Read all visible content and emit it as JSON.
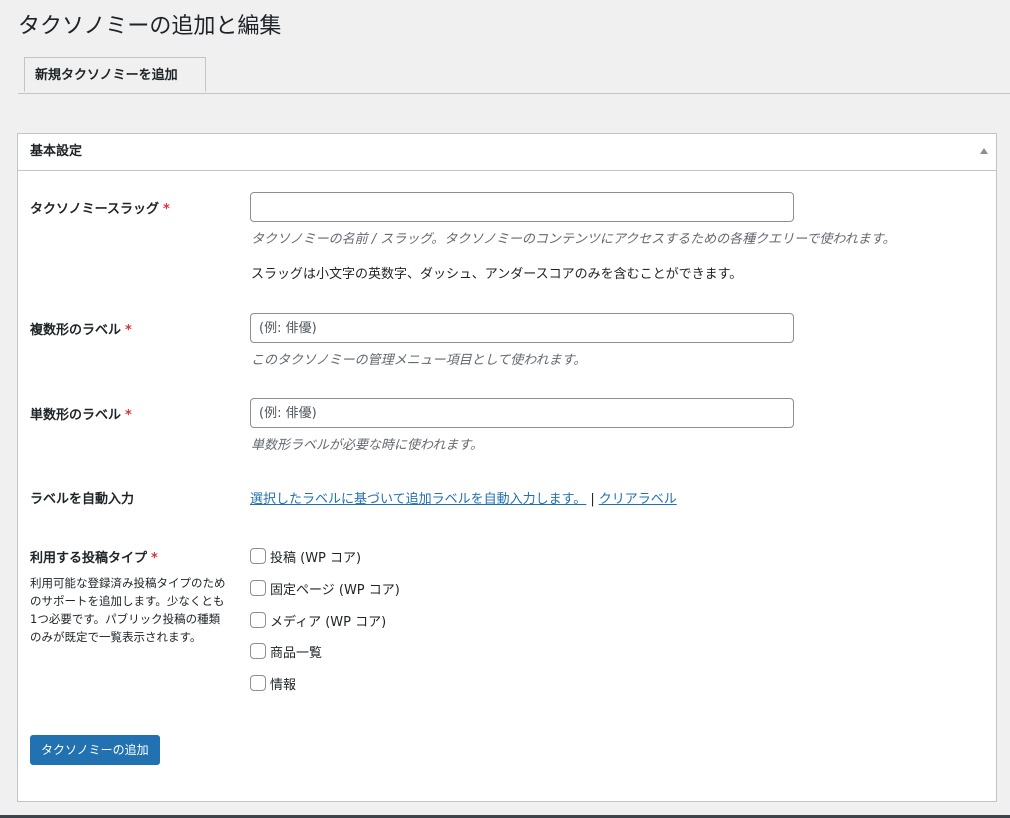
{
  "page": {
    "title": "タクソノミーの追加と編集"
  },
  "tabs": [
    {
      "label": "新規タクソノミーを追加"
    }
  ],
  "panel": {
    "title": "基本設定",
    "required_mark": "*",
    "slug": {
      "label": "タクソノミースラッグ",
      "value": "",
      "placeholder": "",
      "description": "タクソノミーの名前 / スラッグ。タクソノミーのコンテンツにアクセスするための各種クエリーで使われます。",
      "note": "スラッグは小文字の英数字、ダッシュ、アンダースコアのみを含むことができます。"
    },
    "plural": {
      "label": "複数形のラベル",
      "value": "",
      "placeholder": "(例: 俳優)",
      "description": "このタクソノミーの管理メニュー項目として使われます。"
    },
    "singular": {
      "label": "単数形のラベル",
      "value": "",
      "placeholder": "(例: 俳優)",
      "description": "単数形ラベルが必要な時に使われます。"
    },
    "autofill": {
      "label": "ラベルを自動入力",
      "populate_link": "選択したラベルに基づいて追加ラベルを自動入力します。",
      "separator": "|",
      "clear_link": "クリアラベル"
    },
    "post_types": {
      "label": "利用する投稿タイプ",
      "description": "利用可能な登録済み投稿タイプのためのサポートを追加します。少なくとも1つ必要です。パブリック投稿の種類のみが既定で一覧表示されます。",
      "options": [
        {
          "label": "投稿 (WP コア)",
          "checked": false
        },
        {
          "label": "固定ページ (WP コア)",
          "checked": false
        },
        {
          "label": "メディア (WP コア)",
          "checked": false
        },
        {
          "label": "商品一覧",
          "checked": false
        },
        {
          "label": "情報",
          "checked": false
        }
      ]
    },
    "submit_label": "タクソノミーの追加"
  }
}
